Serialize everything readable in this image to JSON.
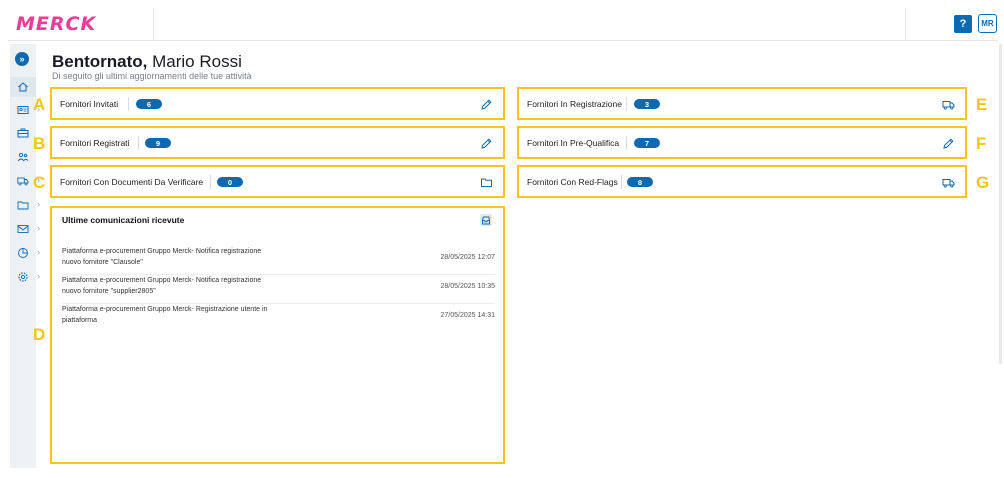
{
  "header": {
    "logo_text": "MERCK",
    "help_label": "?",
    "avatar_initials": "MR"
  },
  "sidebar": {
    "expand_label": "»",
    "items": [
      {
        "icon": "home-icon"
      },
      {
        "icon": "id-card-icon"
      },
      {
        "icon": "briefcase-icon"
      },
      {
        "icon": "users-icon"
      },
      {
        "icon": "truck-icon"
      },
      {
        "icon": "folder-icon"
      },
      {
        "icon": "mail-icon"
      },
      {
        "icon": "chart-pie-icon"
      },
      {
        "icon": "gear-icon"
      }
    ],
    "chevron": "›"
  },
  "welcome": {
    "greeting": "Bentornato,",
    "user_name": "Mario Rossi",
    "subtitle": "Di seguito gli ultimi aggiornamenti delle tue attività"
  },
  "cards": [
    {
      "letter": "A",
      "label": "Fornitori Invitati",
      "count": "6",
      "icon": "pencil-icon"
    },
    {
      "letter": "B",
      "label": "Fornitori Registrati",
      "count": "9",
      "icon": "pencil-icon"
    },
    {
      "letter": "C",
      "label": "Fornitori Con Documenti Da Verificare",
      "count": "0",
      "icon": "folder-icon"
    },
    {
      "letter": "E",
      "label": "Fornitori In Registrazione",
      "count": "3",
      "icon": "truck-icon"
    },
    {
      "letter": "F",
      "label": "Fornitori In Pre-Qualifica",
      "count": "7",
      "icon": "pencil-icon"
    },
    {
      "letter": "G",
      "label": "Fornitori Con Red-Flags",
      "count": "8",
      "icon": "truck-icon"
    }
  ],
  "communications": {
    "letter": "D",
    "title": "Ultime comunicazioni ricevute",
    "icon": "inbox-icon",
    "items": [
      {
        "line1": "Piattaforma e-procurement Gruppo Merck- Notifica registrazione",
        "line2": "nuovo fornitore \"Clausole\"",
        "date": "28/05/2025 12:07"
      },
      {
        "line1": "Piattaforma e-procurement Gruppo Merck- Notifica registrazione",
        "line2": "nuovo fornitore \"supplier2805\"",
        "date": "28/05/2025 10:35"
      },
      {
        "line1": "Piattaforma e-procurement Gruppo Merck- Registrazione utente in",
        "line2": "piattaforma",
        "date": "27/05/2025 14:31"
      }
    ]
  },
  "colors": {
    "accent": "#0f69af",
    "brand": "#eb3c96",
    "highlight": "#f5c518"
  }
}
